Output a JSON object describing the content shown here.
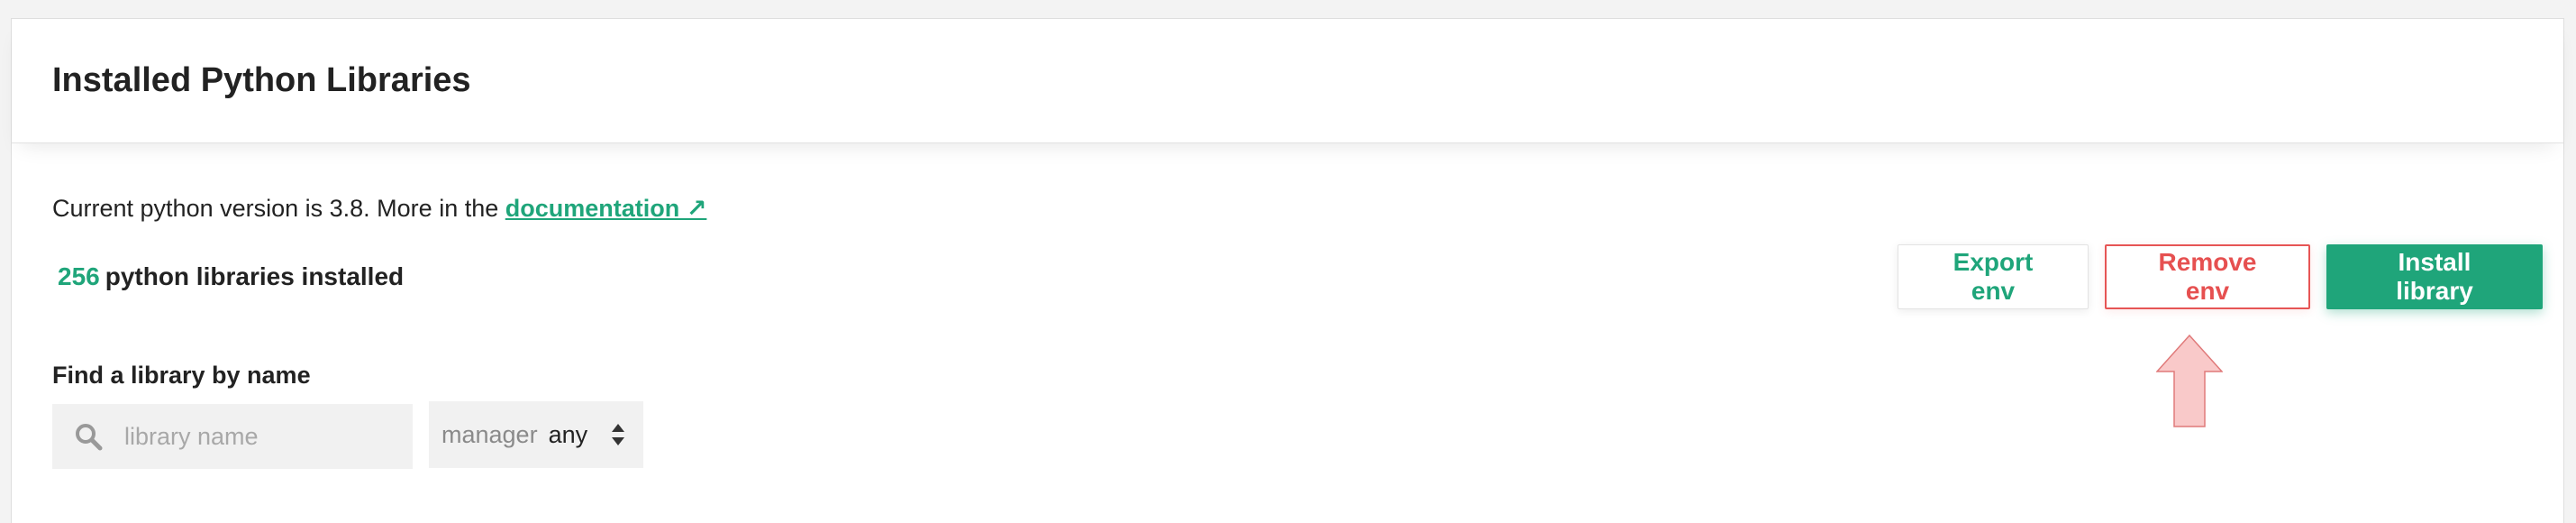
{
  "header": {
    "title": "Installed Python Libraries"
  },
  "info": {
    "version_text": "Current python version is 3.8. More in the ",
    "doc_link": "documentation ↗"
  },
  "summary": {
    "count": "256",
    "count_text": "python libraries installed"
  },
  "actions": {
    "export_label": "Export env",
    "remove_label": "Remove env",
    "install_label": "Install library"
  },
  "filter": {
    "label": "Find a library by name",
    "search_placeholder": "library name",
    "manager_label": "manager",
    "manager_value": "any"
  },
  "colors": {
    "accent": "#1fa57a",
    "danger": "#e65050",
    "annotation_arrow": "#f9c9c9"
  },
  "icons": {
    "search": "search-icon",
    "sort": "sort-arrows-icon",
    "annotation": "arrow-up-icon"
  }
}
